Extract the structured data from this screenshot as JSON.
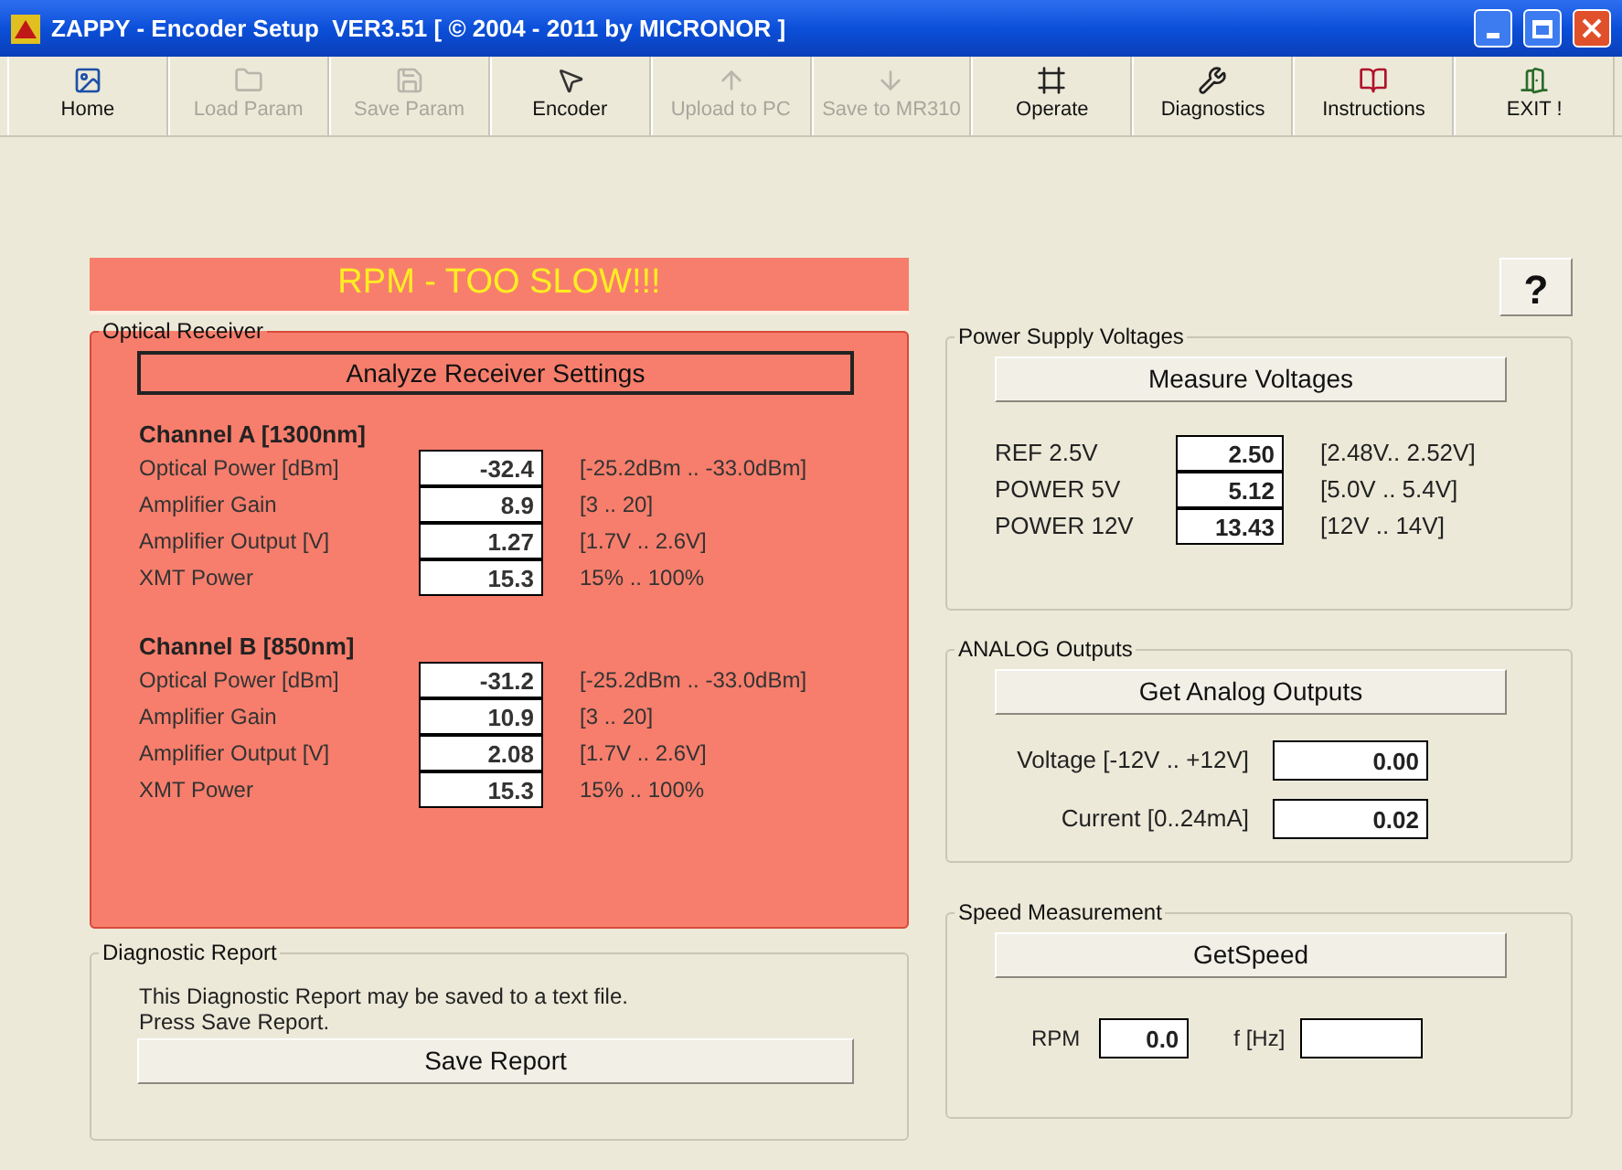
{
  "window": {
    "title": "ZAPPY - Encoder Setup  VER3.51 [ © 2004 - 2011 by MICRONOR ]"
  },
  "toolbar": [
    {
      "kind": "home",
      "label": "Home",
      "disabled": false
    },
    {
      "kind": "folder",
      "label": "Load Param",
      "disabled": true
    },
    {
      "kind": "save",
      "label": "Save Param",
      "disabled": true
    },
    {
      "kind": "encoder",
      "label": "Encoder",
      "disabled": false
    },
    {
      "kind": "upload",
      "label": "Upload to PC",
      "disabled": true
    },
    {
      "kind": "download",
      "label": "Save to MR310",
      "disabled": true
    },
    {
      "kind": "operate",
      "label": "Operate",
      "disabled": false
    },
    {
      "kind": "diagnostics",
      "label": "Diagnostics",
      "disabled": false
    },
    {
      "kind": "instructions",
      "label": "Instructions",
      "disabled": false
    },
    {
      "kind": "exit",
      "label": "EXIT !",
      "disabled": false
    }
  ],
  "alarm": "RPM - TOO SLOW!!!",
  "optical_receiver": {
    "title": "Optical Receiver",
    "button": "Analyze Receiver Settings",
    "channels": [
      {
        "heading": "Channel A [1300nm]",
        "rows": [
          {
            "label": "Optical Power [dBm]",
            "value": "-32.4",
            "range": "[-25.2dBm .. -33.0dBm]"
          },
          {
            "label": "Amplifier Gain",
            "value": "8.9",
            "range": "[3 .. 20]"
          },
          {
            "label": "Amplifier Output [V]",
            "value": "1.27",
            "range": "[1.7V .. 2.6V]"
          },
          {
            "label": "XMT Power",
            "value": "15.3",
            "range": "15% .. 100%"
          }
        ]
      },
      {
        "heading": "Channel B [850nm]",
        "rows": [
          {
            "label": "Optical Power [dBm]",
            "value": "-31.2",
            "range": "[-25.2dBm .. -33.0dBm]"
          },
          {
            "label": "Amplifier Gain",
            "value": "10.9",
            "range": "[3 .. 20]"
          },
          {
            "label": "Amplifier Output [V]",
            "value": "2.08",
            "range": "[1.7V .. 2.6V]"
          },
          {
            "label": "XMT Power",
            "value": "15.3",
            "range": "15% .. 100%"
          }
        ]
      }
    ]
  },
  "diagnostic_report": {
    "title": "Diagnostic Report",
    "lines": [
      "This Diagnostic Report may be saved to a text file.",
      "Press Save Report."
    ],
    "button": "Save Report"
  },
  "help_button": "?",
  "power_supply": {
    "title": "Power Supply Voltages",
    "button": "Measure Voltages",
    "rows": [
      {
        "label": "REF 2.5V",
        "value": "2.50",
        "range": "[2.48V.. 2.52V]"
      },
      {
        "label": "POWER 5V",
        "value": "5.12",
        "range": "[5.0V .. 5.4V]"
      },
      {
        "label": "POWER 12V",
        "value": "13.43",
        "range": "[12V .. 14V]"
      }
    ]
  },
  "analog_outputs": {
    "title": "ANALOG  Outputs",
    "button": "Get Analog Outputs",
    "rows": [
      {
        "label": "Voltage [-12V .. +12V]",
        "value": "0.00"
      },
      {
        "label": "Current [0..24mA]",
        "value": "0.02"
      }
    ]
  },
  "speed": {
    "title": "Speed Measurement",
    "button": "GetSpeed",
    "fields": [
      {
        "label": "RPM",
        "value": "0.0"
      },
      {
        "label": "f [Hz]"
      }
    ]
  }
}
